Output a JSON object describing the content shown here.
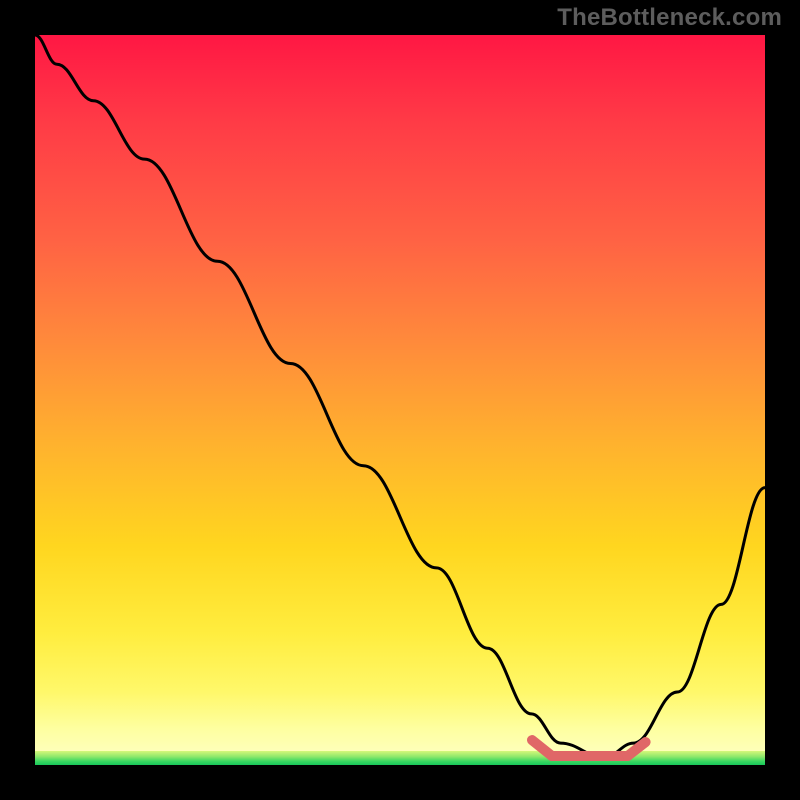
{
  "watermark": "TheBottleneck.com",
  "chart_data": {
    "type": "line",
    "title": "",
    "xlabel": "",
    "ylabel": "",
    "xlim": [
      0,
      100
    ],
    "ylim": [
      0,
      100
    ],
    "series": [
      {
        "name": "bottleneck-curve",
        "x": [
          0,
          3,
          8,
          15,
          25,
          35,
          45,
          55,
          62,
          68,
          72,
          78,
          82,
          88,
          94,
          100
        ],
        "values": [
          100,
          96,
          91,
          83,
          69,
          55,
          41,
          27,
          16,
          7,
          3,
          1,
          3,
          10,
          22,
          38
        ]
      }
    ],
    "optimal_range": {
      "x_start": 70,
      "x_end": 82,
      "y": 1.5
    },
    "background_gradient": {
      "top": "#ff1744",
      "mid": "#ffd61f",
      "bottom": "#feffc8",
      "strip": "#17c85a"
    }
  }
}
